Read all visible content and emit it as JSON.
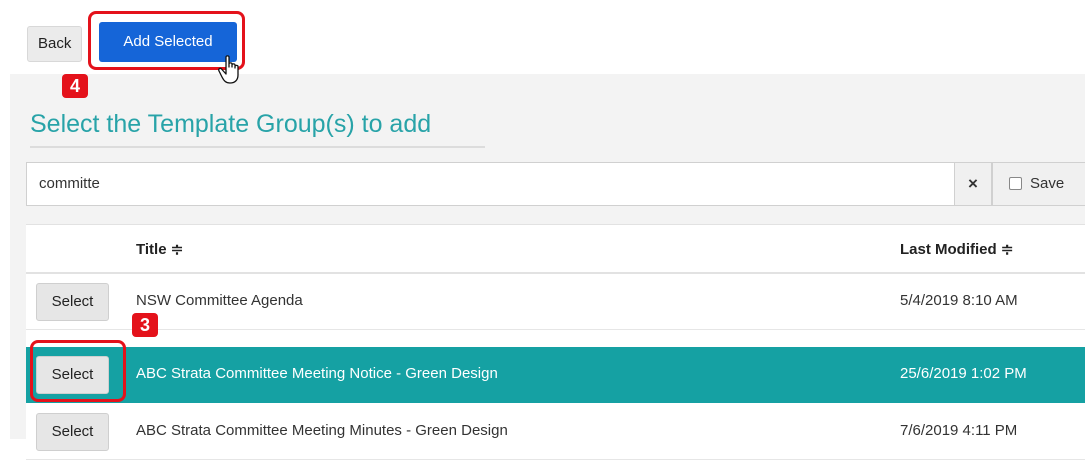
{
  "toolbar": {
    "back_label": "Back",
    "add_selected_label": "Add Selected"
  },
  "callouts": {
    "step4": "4",
    "step3": "3"
  },
  "heading": "Select the Template Group(s) to add",
  "search": {
    "value": "committe",
    "clear_icon": "×",
    "save_label": "Save",
    "save_checked": false
  },
  "table": {
    "columns": [
      "Title ≑",
      "Last Modified ≑"
    ],
    "select_label": "Select",
    "rows": [
      {
        "title": "NSW Committee Agenda",
        "modified": "5/4/2019 8:10 AM",
        "selected": false
      },
      {
        "title": "ABC Strata Committee Meeting Notice - Green Design",
        "modified": "25/6/2019 1:02 PM",
        "selected": true
      },
      {
        "title": "ABC Strata Committee Meeting Minutes - Green Design",
        "modified": "7/6/2019 4:11 PM",
        "selected": false
      }
    ]
  },
  "colors": {
    "accent_teal": "#15a1a3",
    "primary_blue": "#1565d8",
    "highlight_red": "#e4121b",
    "heading_teal": "#28a3a8"
  }
}
